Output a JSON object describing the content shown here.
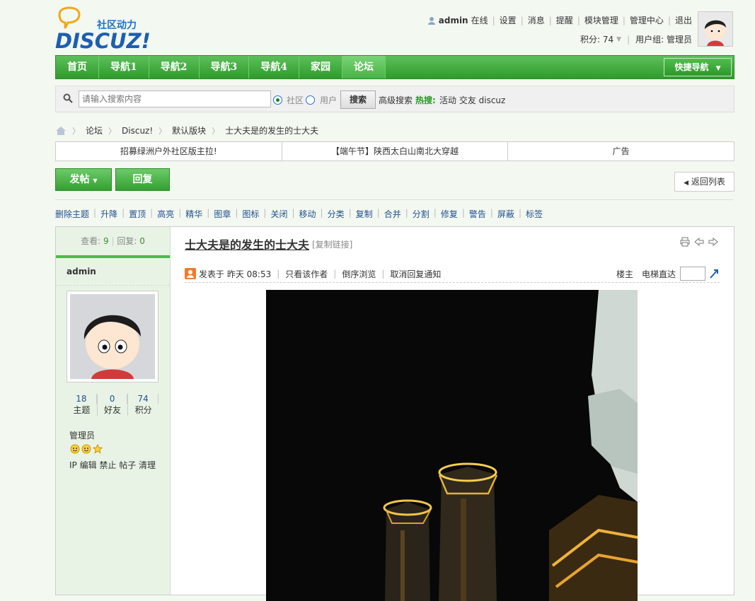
{
  "header": {
    "logo_text": "DISCUZ!",
    "logo_tagline": "社区动力",
    "username": "admin",
    "online": "在线",
    "links": [
      "设置",
      "消息",
      "提醒",
      "模块管理",
      "管理中心",
      "退出"
    ],
    "credits_label": "积分: 74",
    "usergroup": "用户组: 管理员"
  },
  "nav": {
    "items": [
      "首页",
      "导航1",
      "导航2",
      "导航3",
      "导航4",
      "家园",
      "论坛"
    ],
    "active_index": 6,
    "quick_nav": "快捷导航"
  },
  "search": {
    "placeholder": "请输入搜索内容",
    "option_community": "社区",
    "option_user": "用户",
    "button": "搜索",
    "advanced": "高级搜索",
    "hot_label": "热搜:",
    "hot_words": "活动 交友 discuz"
  },
  "breadcrumb": [
    "论坛",
    "Discuz!",
    "默认版块",
    "士大夫是的发生的士大夫"
  ],
  "announcements": [
    "招募绿洲户外社区版主拉!",
    "【端午节】陕西太白山南北大穿越",
    "广告"
  ],
  "actions": {
    "post": "发帖",
    "reply": "回复",
    "back_list": "返回列表"
  },
  "mod_tools": [
    "删除主题",
    "升降",
    "置顶",
    "高亮",
    "精华",
    "图章",
    "图标",
    "关闭",
    "移动",
    "分类",
    "复制",
    "合并",
    "分割",
    "修复",
    "警告",
    "屏蔽",
    "标签"
  ],
  "thread": {
    "views_label": "查看:",
    "views": "9",
    "replies_label": "回复:",
    "replies": "0",
    "title": "士大夫是的发生的士大夫",
    "copy_link": "[复制链接]",
    "posted_at": "发表于 昨天 08:53",
    "only_author": "只看该作者",
    "reverse": "倒序浏览",
    "cancel_notice": "取消回复通知",
    "floor": "楼主",
    "jump_label": "电梯直达"
  },
  "author": {
    "name": "admin",
    "topics": "18",
    "topics_label": "主题",
    "friends": "0",
    "friends_label": "好友",
    "points": "74",
    "points_label": "积分",
    "group": "管理员",
    "admin_links": "IP 编辑 禁止 帖子 清理"
  },
  "colors": {
    "nav_green": "#3aa437",
    "link_blue": "#22518c"
  }
}
